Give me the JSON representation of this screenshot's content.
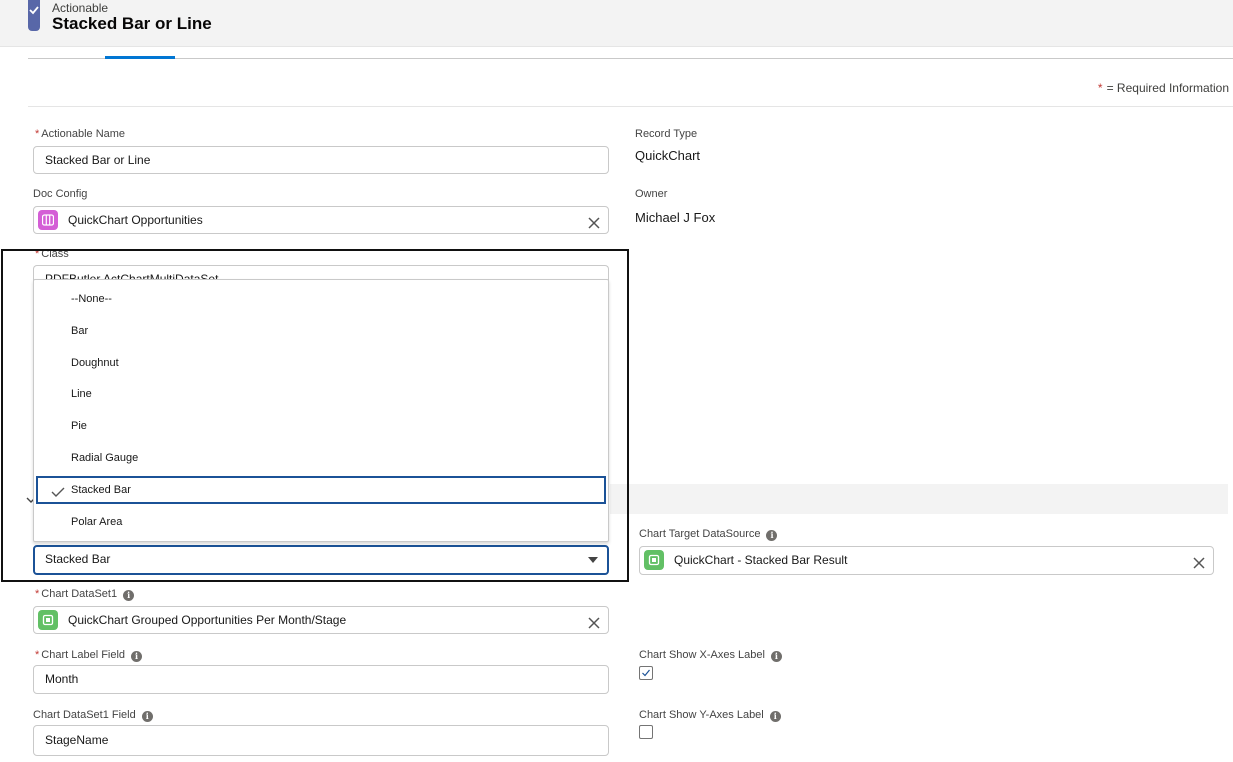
{
  "header": {
    "object_label": "Actionable",
    "title": "Stacked Bar or Line"
  },
  "required_info": {
    "star": "*",
    "text": "= Required Information"
  },
  "form": {
    "actionable_name": {
      "label": "Actionable Name",
      "value": "Stacked Bar or Line"
    },
    "record_type": {
      "label": "Record Type",
      "value": "QuickChart"
    },
    "doc_config": {
      "label": "Doc Config",
      "value": "QuickChart Opportunities"
    },
    "owner": {
      "label": "Owner",
      "value": "Michael J Fox"
    },
    "class": {
      "label": "Class",
      "value_partial": "PDFButler.ActChartMultiDataSet..."
    },
    "chart_type": {
      "value": "Stacked Bar"
    },
    "chart_target_datasource": {
      "label": "Chart Target DataSource",
      "value": "QuickChart - Stacked Bar Result"
    },
    "chart_dataset1": {
      "label": "Chart DataSet1",
      "value": "QuickChart Grouped Opportunities Per Month/Stage"
    },
    "chart_label_field": {
      "label": "Chart Label Field",
      "value": "Month"
    },
    "chart_show_x_axes_label": {
      "label": "Chart Show X-Axes Label",
      "checked": true
    },
    "chart_dataset1_field": {
      "label": "Chart DataSet1 Field",
      "value": "StageName"
    },
    "chart_show_y_axes_label": {
      "label": "Chart Show Y-Axes Label",
      "checked": false
    }
  },
  "dropdown": {
    "options": [
      "--None--",
      "Bar",
      "Doughnut",
      "Line",
      "Pie",
      "Radial Gauge",
      "Stacked Bar",
      "Polar Area"
    ],
    "selected": "Stacked Bar"
  },
  "colors": {
    "accent": "#0176d3",
    "focus_border": "#1b5297",
    "required": "#c23934",
    "doc_config_icon": "#d45ed6",
    "datasource_icon": "#62c065"
  },
  "icons": {
    "header": "check-icon",
    "lookup_doc_config": "grid-icon",
    "lookup_datasource": "chip-icon",
    "clear": "close-icon",
    "dropdown": "chevron-down-icon",
    "info": "info-icon"
  }
}
